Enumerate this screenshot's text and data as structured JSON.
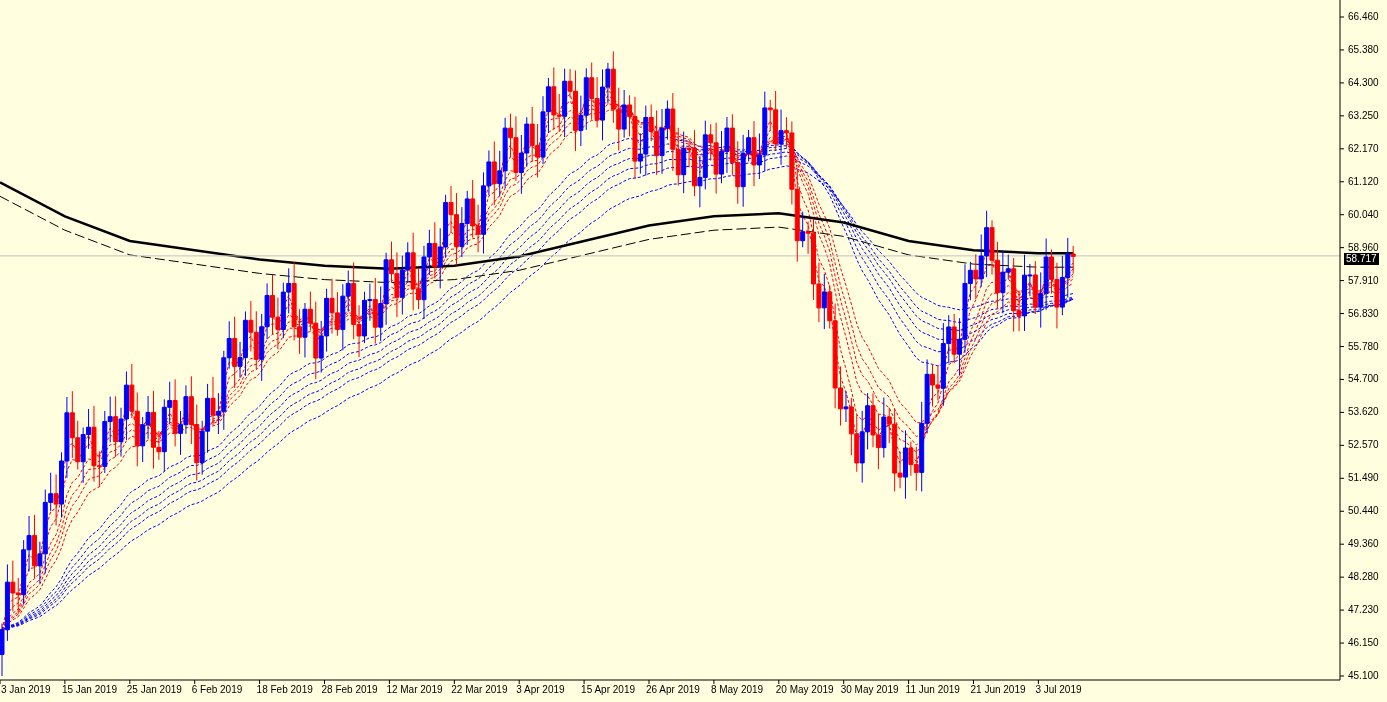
{
  "chart": {
    "current_price": "58.717",
    "price_axis": {
      "labels": [
        "66.460",
        "65.380",
        "64.300",
        "63.250",
        "62.170",
        "61.120",
        "60.040",
        "58.960",
        "57.910",
        "56.830",
        "55.780",
        "54.700",
        "53.620",
        "52.570",
        "51.490",
        "50.440",
        "49.360",
        "48.280",
        "47.230",
        "46.150",
        "45.100"
      ]
    },
    "time_axis": {
      "labels": [
        "3 Jan 2019",
        "15 Jan 2019",
        "25 Jan 2019",
        "6 Feb 2019",
        "18 Feb 2019",
        "28 Feb 2019",
        "12 Mar 2019",
        "22 Mar 2019",
        "3 Apr 2019",
        "15 Apr 2019",
        "26 Apr 2019",
        "8 May 2019",
        "20 May 2019",
        "30 May 2019",
        "11 Jun 2019",
        "21 Jun 2019",
        "3 Jul 2019"
      ]
    }
  }
}
